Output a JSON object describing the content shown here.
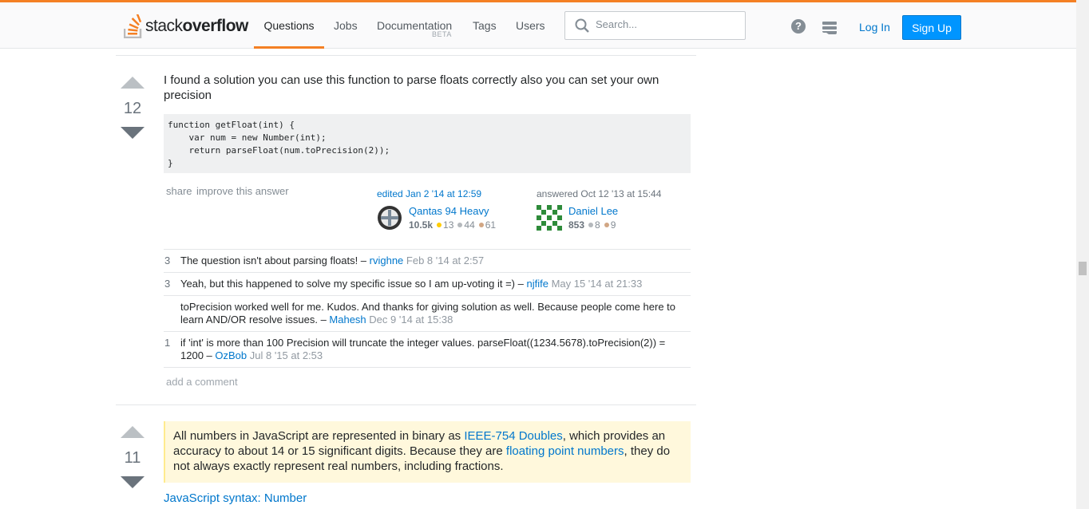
{
  "header": {
    "logo_text_light": "stack",
    "logo_text_bold": "overflow",
    "nav": [
      {
        "label": "Questions"
      },
      {
        "label": "Jobs"
      },
      {
        "label": "Documentation",
        "badge": "BETA"
      },
      {
        "label": "Tags"
      },
      {
        "label": "Users"
      }
    ],
    "search_placeholder": "Search...",
    "help_glyph": "?",
    "login_label": "Log In",
    "signup_label": "Sign Up"
  },
  "answer1": {
    "votes": "12",
    "text": "I found a solution you can use this function to parse floats correctly also you can set your own precision",
    "code": "function getFloat(int) {\n    var num = new Number(int);\n    return parseFloat(num.toPrecision(2));\n}",
    "menu": {
      "share": "share",
      "improve": "improve this answer"
    },
    "editor": {
      "action": "edited Jan 2 '14 at 12:59",
      "name": "Qantas 94 Heavy",
      "rep": "10.5k",
      "gold": "13",
      "silver": "44",
      "bronze": "61"
    },
    "author": {
      "action": "answered Oct 12 '13 at 15:44",
      "name": "Daniel Lee",
      "rep": "853",
      "silver": "8",
      "bronze": "9"
    },
    "comments": [
      {
        "score": "3",
        "text": "The question isn't about parsing floats! – ",
        "user": "rvighne",
        "date": "Feb 8 '14 at 2:57"
      },
      {
        "score": "3",
        "text": "Yeah, but this happened to solve my specific issue so I am up-voting it =) – ",
        "user": "njfife",
        "date": "May 15 '14 at 21:33"
      },
      {
        "score": "",
        "text": "toPrecision worked well for me. Kudos. And thanks for giving solution as well. Because people come here to learn AND/OR resolve issues. – ",
        "user": "Mahesh",
        "date": "Dec 9 '14 at 15:38"
      },
      {
        "score": "1",
        "text": "if 'int' is more than 100 Precision will truncate the integer values. parseFloat((1234.5678).toPrecision(2)) = 1200 – ",
        "user": "OzBob",
        "date": "Jul 8 '15 at 2:53"
      }
    ],
    "add_comment": "add a comment"
  },
  "answer2": {
    "votes": "11",
    "quote_part1": "All numbers in JavaScript are represented in binary as ",
    "quote_link1": "IEEE-754 Doubles",
    "quote_part2": ", which provides an accuracy to about 14 or 15 significant digits. Because they are ",
    "quote_link2": "floating point numbers",
    "quote_part3": ", they do not always exactly represent real numbers, including fractions.",
    "link": "JavaScript syntax: Number"
  },
  "colors": {
    "accent": "#f48024",
    "link": "#07c",
    "signup_bg": "#0095ff",
    "quote_bg": "#fff8dc"
  }
}
